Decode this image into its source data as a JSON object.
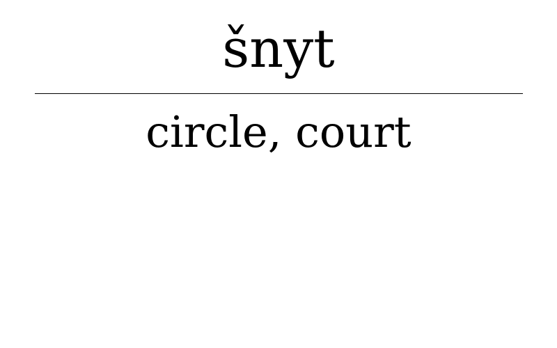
{
  "card": {
    "headword": "šnyt",
    "gloss": "circle, court"
  }
}
